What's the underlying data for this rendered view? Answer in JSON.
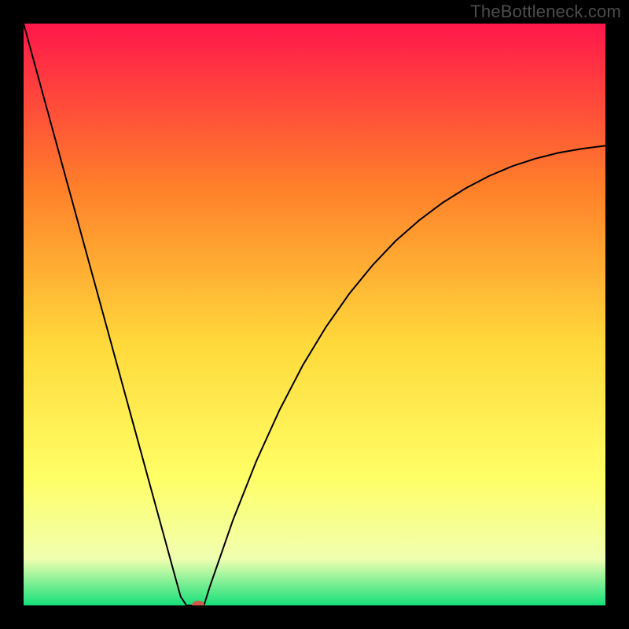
{
  "watermark": "TheBottleneck.com",
  "chart_data": {
    "type": "line",
    "title": "",
    "xlabel": "",
    "ylabel": "",
    "xlim": [
      0,
      100
    ],
    "ylim": [
      0,
      100
    ],
    "grid": false,
    "legend": false,
    "background_gradient": {
      "top": "#ff174b",
      "upper_mid": "#ff7f2a",
      "mid": "#ffd93b",
      "lower_mid": "#ffff66",
      "near_bottom": "#f0ffb0",
      "bottom": "#15e07a"
    },
    "series": [
      {
        "name": "bottleneck-curve",
        "type": "line",
        "color": "#000000",
        "stroke_width": 2,
        "x": [
          0,
          2,
          4,
          6,
          8,
          10,
          12,
          14,
          16,
          18,
          20,
          22,
          24,
          26,
          27,
          28,
          29,
          30,
          31,
          32,
          36,
          40,
          44,
          48,
          52,
          56,
          60,
          64,
          68,
          72,
          76,
          80,
          84,
          88,
          92,
          96,
          100
        ],
        "y": [
          100,
          92.7,
          85.4,
          78.1,
          70.8,
          63.5,
          56.2,
          48.9,
          41.6,
          34.3,
          27.0,
          19.7,
          12.4,
          5.1,
          1.5,
          0.0,
          0.0,
          0.0,
          0.0,
          3.2,
          14.7,
          24.8,
          33.6,
          41.3,
          47.9,
          53.6,
          58.5,
          62.7,
          66.2,
          69.2,
          71.7,
          73.8,
          75.5,
          76.8,
          77.8,
          78.5,
          79.0
        ]
      }
    ],
    "marker": {
      "name": "optimal-point",
      "x": 30,
      "y": 0,
      "color": "#cf5a4a",
      "rx": 8,
      "ry": 6
    }
  }
}
